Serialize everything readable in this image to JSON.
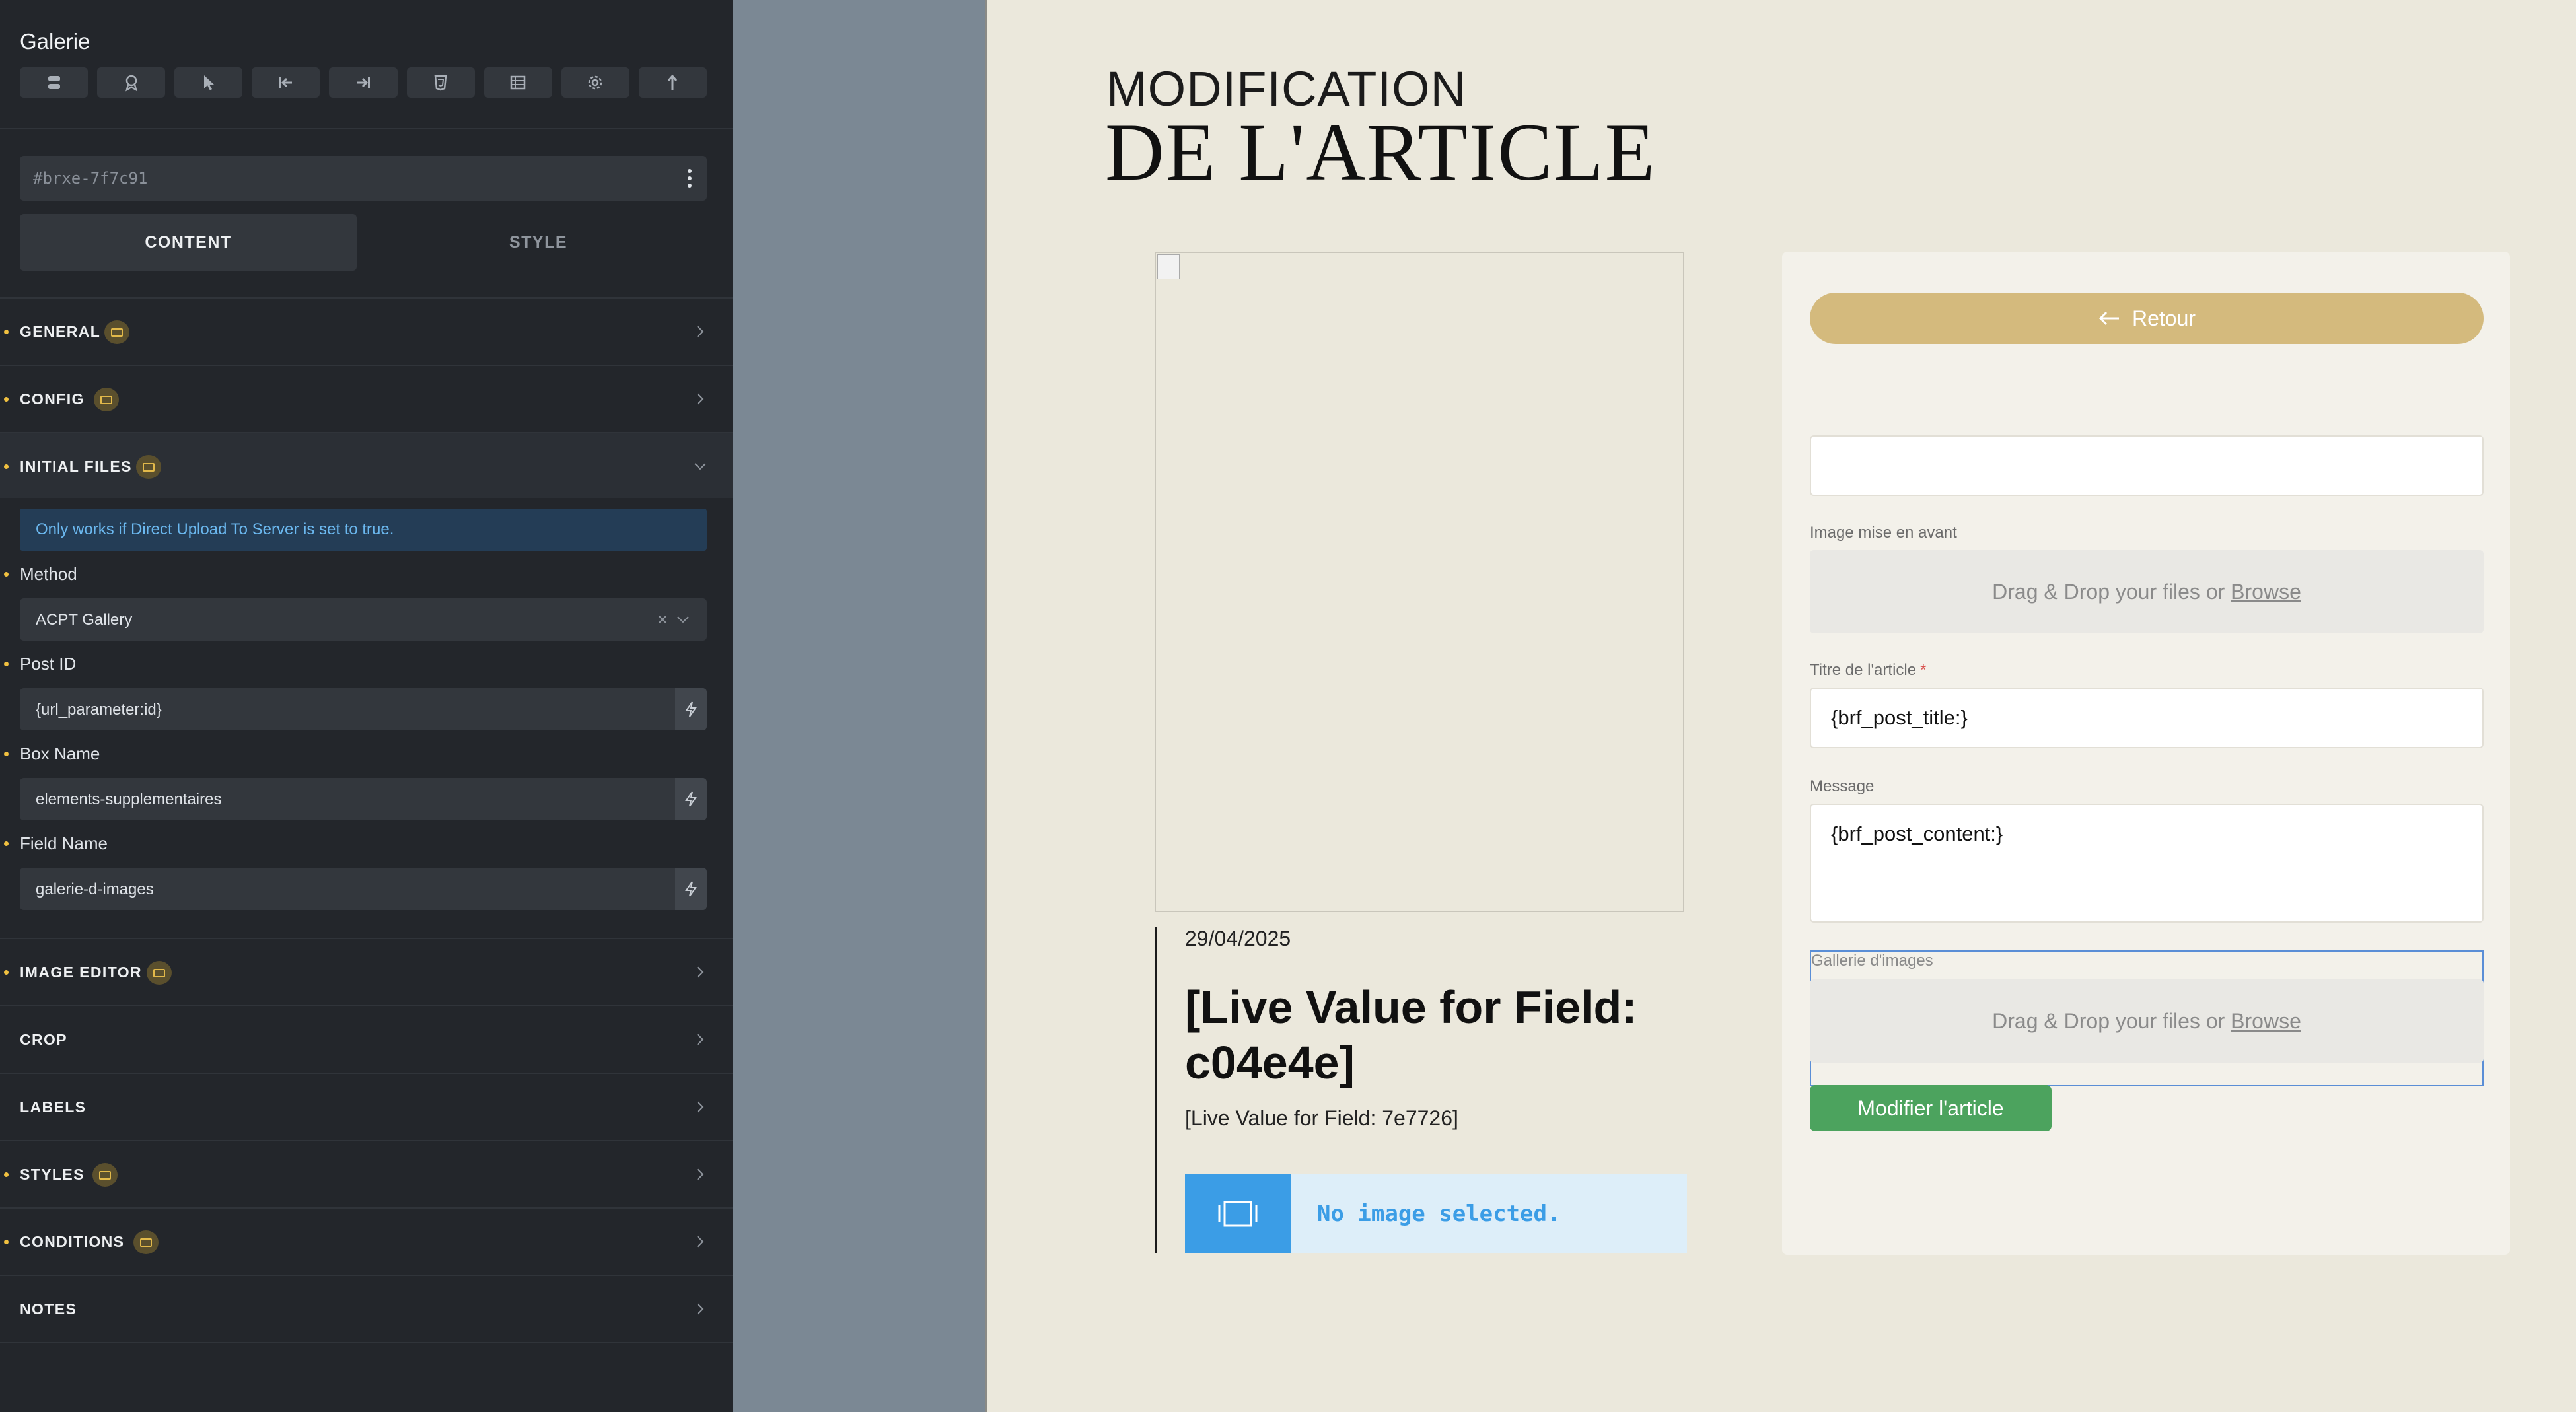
{
  "panel": {
    "title": "Galerie",
    "toolbar_icons": [
      "layers-icon",
      "badge-icon",
      "cursor-icon",
      "arrow-left-bar-icon",
      "arrow-right-bar-icon",
      "css-icon",
      "table-icon",
      "gear-icon",
      "share-icon"
    ],
    "element_id": "#brxe-7f7c91",
    "tabs": [
      "CONTENT",
      "STYLE"
    ],
    "sections_top": [
      {
        "label": "GENERAL",
        "badge": true
      },
      {
        "label": "CONFIG",
        "badge": true
      },
      {
        "label": "INITIAL FILES",
        "badge": true,
        "open": true
      }
    ],
    "initial_files": {
      "note": "Only works if Direct Upload To Server is set to true.",
      "method_label": "Method",
      "method_value": "ACPT Gallery",
      "post_id_label": "Post ID",
      "post_id_value": "{url_parameter:id}",
      "box_name_label": "Box Name",
      "box_name_value": "elements-supplementaires",
      "field_name_label": "Field Name",
      "field_name_value": "galerie-d-images"
    },
    "sections_bottom": [
      {
        "label": "IMAGE EDITOR",
        "badge": true,
        "dot": true
      },
      {
        "label": "CROP",
        "badge": false,
        "dot": false
      },
      {
        "label": "LABELS",
        "badge": false,
        "dot": false
      },
      {
        "label": "STYLES",
        "badge": true,
        "dot": true
      },
      {
        "label": "CONDITIONS",
        "badge": true,
        "dot": true
      },
      {
        "label": "NOTES",
        "badge": false,
        "dot": false
      }
    ]
  },
  "canvas": {
    "heading_line1": "MODIFICATION",
    "heading_line2": "DE L'ARTICLE",
    "post": {
      "date": "29/04/2025",
      "title": "[Live Value for Field: c04e4e]",
      "content": "[Live Value for Field: 7e7726]",
      "no_image": "No image selected."
    },
    "form": {
      "back_label": "Retour",
      "featured_label": "Image mise en avant",
      "drop_text": "Drag & Drop your files or ",
      "browse": "Browse",
      "title_label": "Titre de l'article",
      "required_mark": "*",
      "title_value": "{brf_post_title:}",
      "message_label": "Message",
      "message_value": "{brf_post_content:}",
      "gallery_label": "Gallerie d'images",
      "submit_label": "Modifier l'article"
    }
  },
  "colors": {
    "panel_bg": "#23262b",
    "canvas_bg": "#ebe8dc",
    "accent_gold": "#d4ba7d",
    "submit_green": "#4ca35e",
    "info_blue": "#3b9de6",
    "badge_yellow": "#e2b94a"
  }
}
